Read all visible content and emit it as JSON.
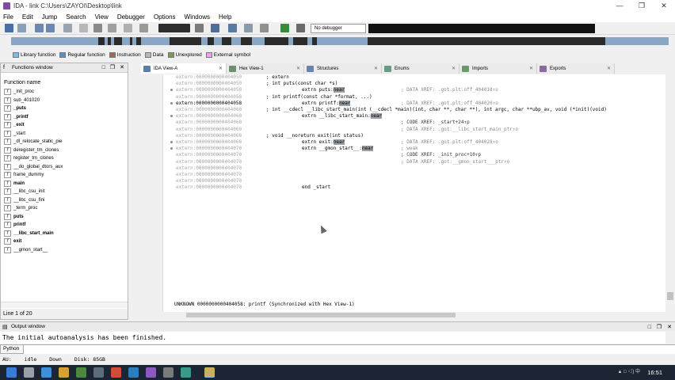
{
  "window": {
    "title": "IDA - link C:\\Users\\ZAYOI\\Desktop\\link"
  },
  "menu": [
    "File",
    "Edit",
    "Jump",
    "Search",
    "View",
    "Debugger",
    "Options",
    "Windows",
    "Help"
  ],
  "toolbar": {
    "debugger_select": "No debugger"
  },
  "legend": [
    {
      "label": "Library function",
      "color": "#6ec0e6"
    },
    {
      "label": "Regular function",
      "color": "#5c8fc7"
    },
    {
      "label": "Instruction",
      "color": "#9c6b52"
    },
    {
      "label": "Data",
      "color": "#b7b7b7"
    },
    {
      "label": "Unexplored",
      "color": "#7a9955"
    },
    {
      "label": "External symbol",
      "color": "#f0a0f0"
    }
  ],
  "functions": {
    "title": "Functions window",
    "column": "Function name",
    "items": [
      {
        "name": "_init_proc",
        "bold": false
      },
      {
        "name": "sub_401020",
        "bold": false
      },
      {
        "name": "_puts",
        "bold": true
      },
      {
        "name": "_printf",
        "bold": true
      },
      {
        "name": "_exit",
        "bold": true
      },
      {
        "name": "_start",
        "bold": false
      },
      {
        "name": "_dl_relocate_static_pie",
        "bold": false
      },
      {
        "name": "deregister_tm_clones",
        "bold": false
      },
      {
        "name": "register_tm_clones",
        "bold": false
      },
      {
        "name": "__do_global_dtors_aux",
        "bold": false
      },
      {
        "name": "frame_dummy",
        "bold": false
      },
      {
        "name": "main",
        "bold": true
      },
      {
        "name": "__libc_csu_init",
        "bold": false
      },
      {
        "name": "__libc_csu_fini",
        "bold": false
      },
      {
        "name": "_term_proc",
        "bold": false
      },
      {
        "name": "puts",
        "bold": true
      },
      {
        "name": "printf",
        "bold": true
      },
      {
        "name": "__libc_start_main",
        "bold": true
      },
      {
        "name": "exit",
        "bold": true
      },
      {
        "name": "__gmon_start__",
        "bold": false
      }
    ],
    "status": "Line 1 of 20"
  },
  "tabs": [
    {
      "label": "IDA View-A",
      "active": true,
      "color": "#5b7fa8"
    },
    {
      "label": "Hex View-1",
      "active": false,
      "color": "#6f8f6f"
    },
    {
      "label": "Structures",
      "active": false,
      "color": "#6a84a8"
    },
    {
      "label": "Enums",
      "active": false,
      "color": "#6a9a84"
    },
    {
      "label": "Imports",
      "active": false,
      "color": "#6a9a6a"
    },
    {
      "label": "Exports",
      "active": false,
      "color": "#8a6a9a"
    }
  ],
  "disasm": [
    {
      "addr": "extern:0000000000404050",
      "code": "; extern",
      "com": ""
    },
    {
      "addr": "extern:0000000000404050",
      "code": "; int puts(const char *s)",
      "com": ""
    },
    {
      "addr": "extern:0000000000404050",
      "code": "extrn puts:near",
      "com": "; DATA XREF: .got.plt:off_404018↑o",
      "mark": true,
      "hl": "near"
    },
    {
      "addr": "extern:0000000000404058",
      "code": "; int printf(const char *format, ...)",
      "com": ""
    },
    {
      "addr": "extern:0000000000404058",
      "code": "extrn printf:near",
      "com": "; DATA XREF: .got.plt:off_404020↑o",
      "mark": true,
      "cur": true,
      "hl": "near"
    },
    {
      "addr": "extern:0000000000404060",
      "code": "; int __cdecl __libc_start_main(int (__cdecl *main)(int, char **, char **), int argc, char **ubp_av, void (*init)(void)",
      "com": ""
    },
    {
      "addr": "extern:0000000000404060",
      "code": "extrn __libc_start_main:near",
      "com": "",
      "mark": true,
      "hl": "near"
    },
    {
      "addr": "extern:0000000000404060",
      "code": "",
      "com": "; CODE XREF: _start+24↑p",
      "dark": true
    },
    {
      "addr": "extern:0000000000404060",
      "code": "",
      "com": "; DATA XREF: .got:__libc_start_main_ptr↑o"
    },
    {
      "addr": "extern:0000000000404068",
      "code": "; void __noreturn exit(int status)",
      "com": ""
    },
    {
      "addr": "extern:0000000000404068",
      "code": "extrn exit:near",
      "com": "; DATA XREF: .got.plt:off_404028↑o",
      "mark": true,
      "hl": "near"
    },
    {
      "addr": "extern:0000000000404070",
      "code": "extrn __gmon_start__:near",
      "com": "; weak",
      "mark": true,
      "hl": "near"
    },
    {
      "addr": "extern:0000000000404070",
      "code": "",
      "com": "; CODE XREF: _init_proc+10↑p",
      "dark": true
    },
    {
      "addr": "extern:0000000000404070",
      "code": "",
      "com": "; DATA XREF: .got:__gmon_start___ptr↑o"
    },
    {
      "addr": "extern:0000000000404070",
      "code": "",
      "com": ""
    },
    {
      "addr": "extern:0000000000404070",
      "code": "",
      "com": ""
    },
    {
      "addr": "extern:0000000000404070",
      "code": "",
      "com": ""
    },
    {
      "addr": "extern:0000000000404070",
      "code": "end _start",
      "com": ""
    }
  ],
  "disasm_status": "UNKNOWN 0000000000404058: printf (Synchronized with Hex View-1)",
  "output": {
    "title": "Output window",
    "text": "The initial autoanalysis has been finished.",
    "python_label": "Python"
  },
  "statusbar": [
    "AU:",
    "idle",
    "Down",
    "Disk: 85GB"
  ],
  "taskbar": {
    "time": "16:51",
    "tray": "▲ □ ◁) 中"
  }
}
